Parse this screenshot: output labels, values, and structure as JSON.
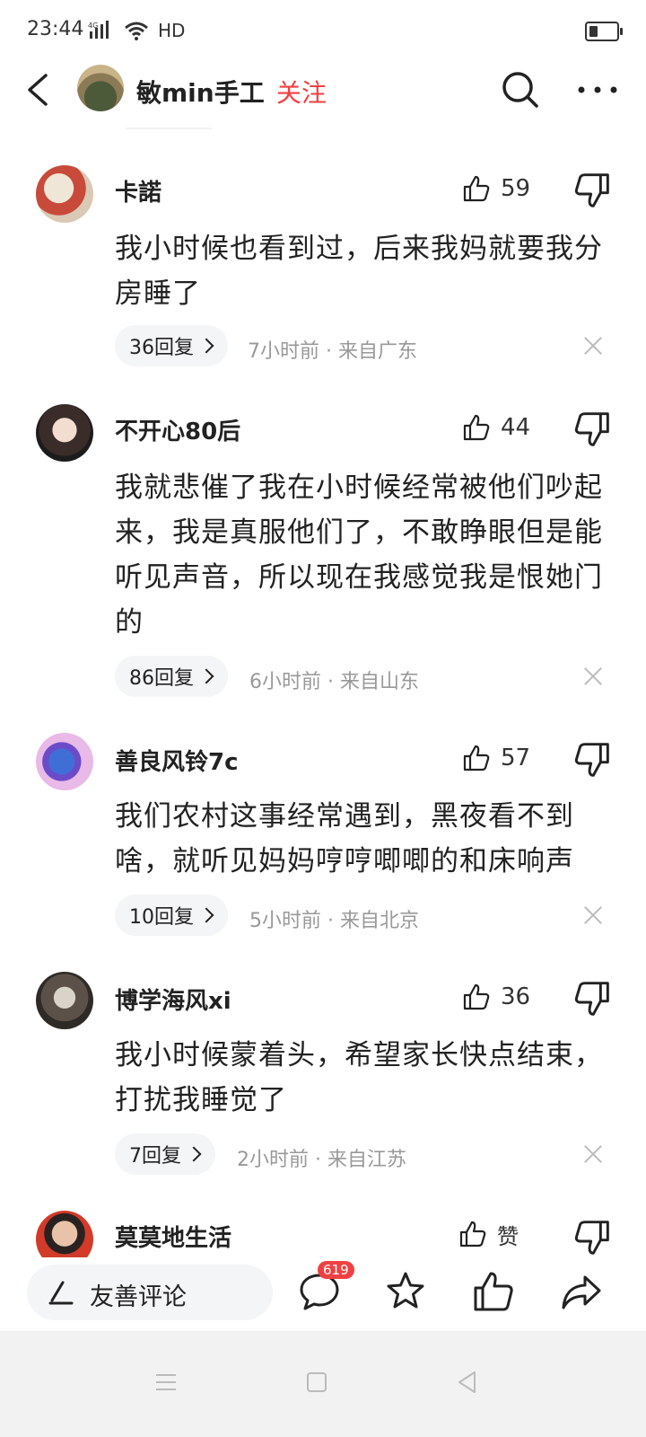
{
  "status_bar": {
    "time": "23:44",
    "network": "4G",
    "hd": "HD"
  },
  "header": {
    "author": "敏min手工",
    "follow": "关注"
  },
  "comments": [
    {
      "user": "卡諾",
      "likes": "59",
      "lines": [
        "我小时候也看到过，后来我妈就要我分",
        "房睡了"
      ],
      "replies": "36回复",
      "meta": "7小时前 · 来自广东"
    },
    {
      "user": "不开心80后",
      "likes": "44",
      "lines": [
        "我就悲催了我在小时候经常被他们吵起",
        "来，我是真服他们了，不敢睁眼但是能",
        "听见声音，所以现在我感觉我是恨她门",
        "的"
      ],
      "replies": "86回复",
      "meta": "6小时前 · 来自山东"
    },
    {
      "user": "善良风铃7c",
      "likes": "57",
      "lines": [
        "我们农村这事经常遇到，黑夜看不到",
        "啥，就听见妈妈哼哼唧唧的和床响声"
      ],
      "replies": "10回复",
      "meta": "5小时前 · 来自北京"
    },
    {
      "user": "博学海风xi",
      "likes": "36",
      "lines": [
        "我小时候蒙着头，希望家长快点结束，",
        "打扰我睡觉了"
      ],
      "replies": "7回复",
      "meta": "2小时前 · 来自江苏"
    },
    {
      "user": "莫莫地生活",
      "likes": "赞"
    }
  ],
  "bottom": {
    "placeholder": "友善评论",
    "comment_count": "619"
  }
}
